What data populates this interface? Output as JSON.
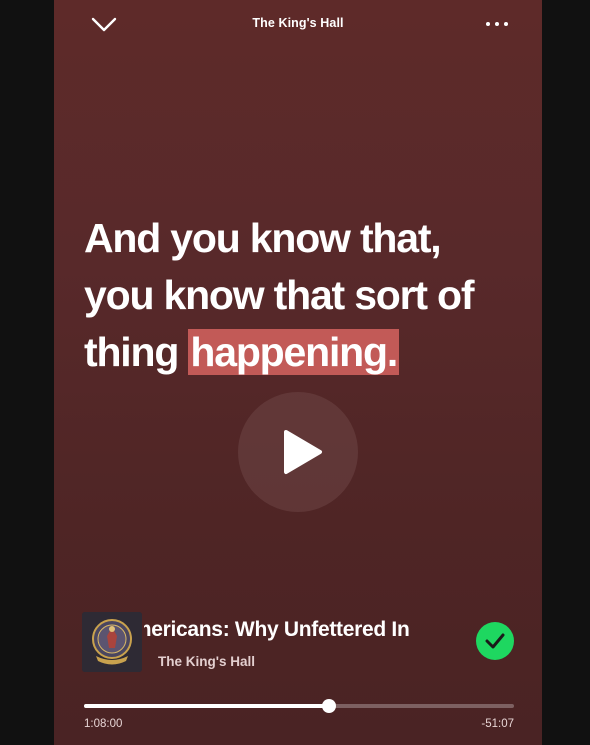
{
  "header": {
    "title": "The King's Hall",
    "collapse_icon": "chevron-down-icon",
    "menu_icon": "more-horizontal-icon"
  },
  "transcript": {
    "line1": "And you know that,",
    "line2": "you know that sort of",
    "line3_prefix": "thing ",
    "line3_highlight": "happening.",
    "highlight_color": "#c25a57"
  },
  "player": {
    "play_icon": "play-icon",
    "episode_title": "Americans: Why Unfettered In",
    "show_name": "The King's Hall",
    "saved_icon": "check-circle-icon",
    "saved_color": "#1ed760",
    "elapsed": "1:08:00",
    "remaining": "-51:07",
    "progress": 0.57
  },
  "colors": {
    "background_top": "#5e2a29",
    "background_bottom": "#4a2324"
  }
}
